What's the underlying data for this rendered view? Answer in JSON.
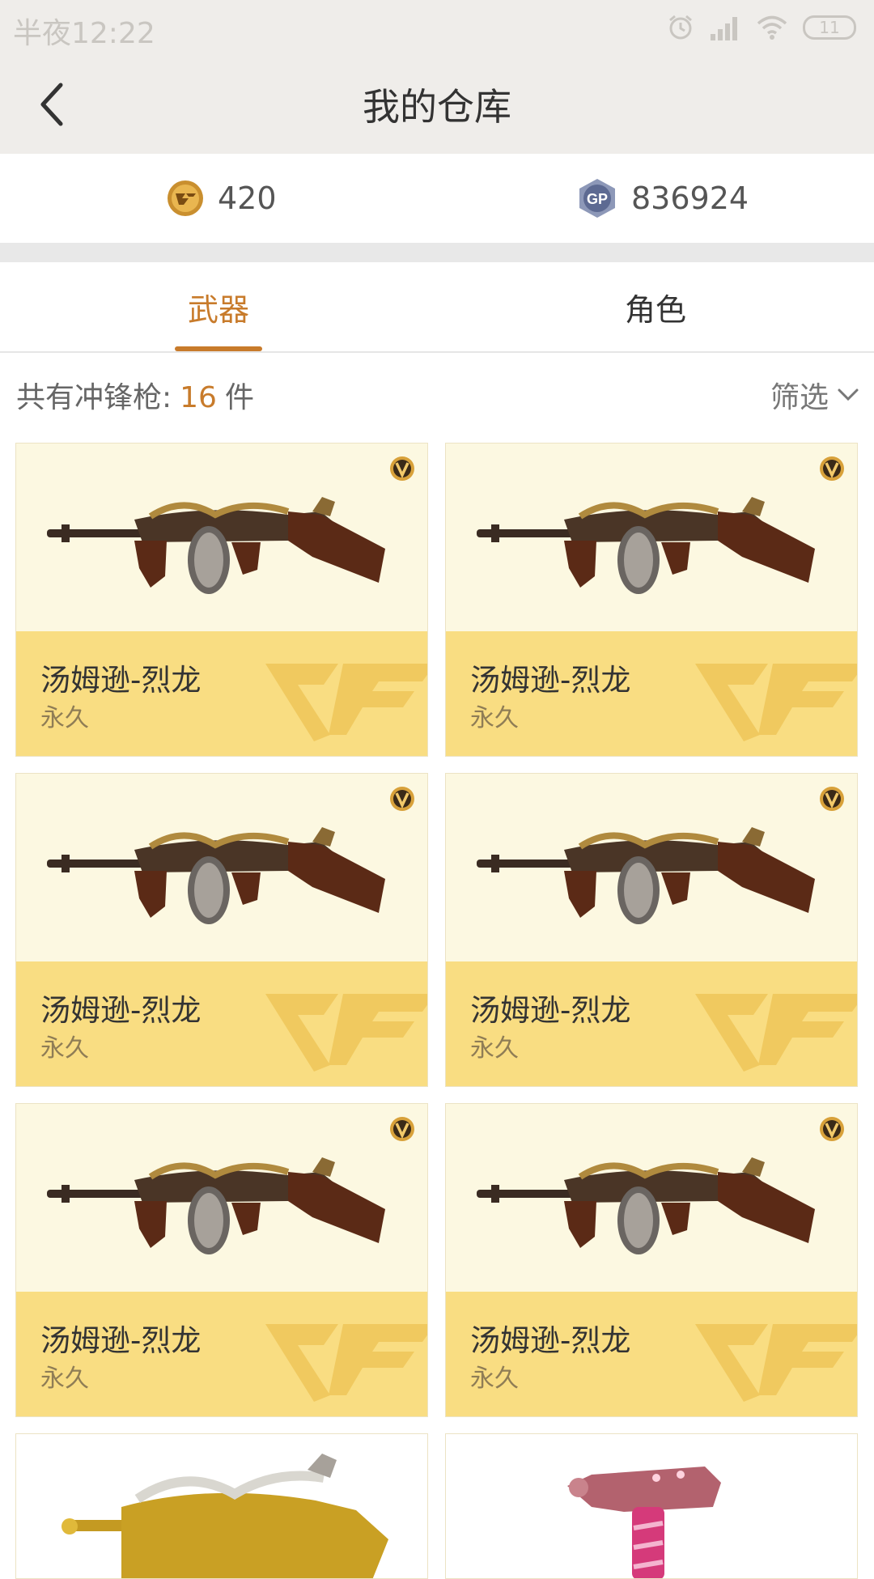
{
  "status_bar": {
    "time": "半夜12:22",
    "battery": "11"
  },
  "header": {
    "title": "我的仓库"
  },
  "currency": [
    {
      "icon": "cf-coin-icon",
      "value": "420"
    },
    {
      "icon": "gp-coin-icon",
      "value": "836924"
    }
  ],
  "tabs": [
    {
      "label": "武器",
      "active": true
    },
    {
      "label": "角色",
      "active": false
    }
  ],
  "summary": {
    "prefix": "共有冲锋枪:",
    "count": "16",
    "suffix": "件"
  },
  "filter": {
    "label": "筛选"
  },
  "items": [
    {
      "name": "汤姆逊-烈龙",
      "duration": "永久"
    },
    {
      "name": "汤姆逊-烈龙",
      "duration": "永久"
    },
    {
      "name": "汤姆逊-烈龙",
      "duration": "永久"
    },
    {
      "name": "汤姆逊-烈龙",
      "duration": "永久"
    },
    {
      "name": "汤姆逊-烈龙",
      "duration": "永久"
    },
    {
      "name": "汤姆逊-烈龙",
      "duration": "永久"
    }
  ],
  "colors": {
    "accent": "#c87b2b",
    "card_top": "#fcf8e1",
    "card_bottom": "#f9dd82",
    "header_bg": "#efedea"
  }
}
